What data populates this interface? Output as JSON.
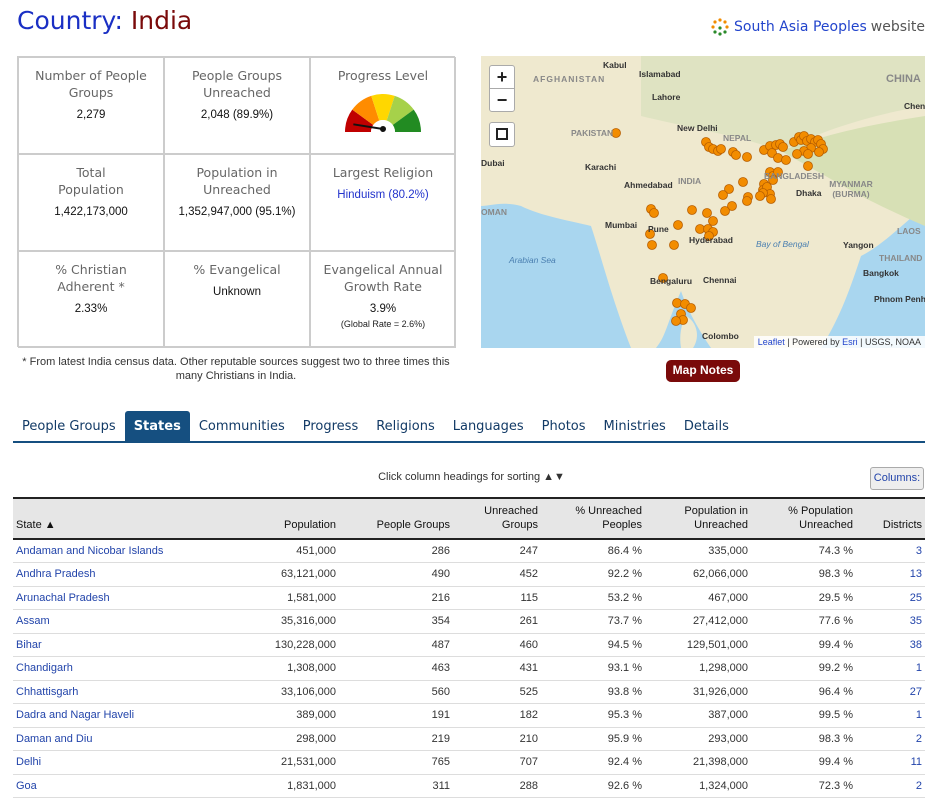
{
  "title": {
    "label": "Country:",
    "value": "India"
  },
  "sap_link": {
    "name": "South Asia Peoples",
    "suffix": "website"
  },
  "stats": {
    "num_groups": {
      "label": "Number of People Groups",
      "value": "2,279"
    },
    "unreached": {
      "label": "People Groups Unreached",
      "value": "2,048 (89.9%)"
    },
    "progress": {
      "label": "Progress Level",
      "level_fraction": 0.05,
      "colors": [
        "#c00000",
        "#ff8c00",
        "#ffd700",
        "#a6d14a",
        "#228b22"
      ]
    },
    "total_pop": {
      "label": "Total Population",
      "value": "1,422,173,000"
    },
    "pop_unreached": {
      "label": "Population in Unreached",
      "value": "1,352,947,000 (95.1%)"
    },
    "religion": {
      "label": "Largest Religion",
      "value": "Hinduism (80.2%)"
    },
    "christian": {
      "label": "% Christian Adherent *",
      "value": "2.33%"
    },
    "evangelical": {
      "label": "% Evangelical",
      "value": "Unknown"
    },
    "growth": {
      "label": "Evangelical Annual Growth Rate",
      "value": "3.9%",
      "note": "(Global Rate = 2.6%)"
    }
  },
  "footnote": "* From latest India census data. Other reputable sources suggest two to three times this many Christians in India.",
  "map": {
    "zoom_in": "+",
    "zoom_out": "−",
    "fullscreen_icon": "fullscreen-icon",
    "labels": {
      "kabul": "Kabul",
      "islamabad": "Islamabad",
      "lahore": "Lahore",
      "afghanistan": "AFGHANISTAN",
      "pakistan": "PAKISTAN",
      "newdelhi": "New Delhi",
      "nepal": "NEPAL",
      "china": "CHINA",
      "chen": "Chen",
      "dubai": "Dubai",
      "karachi": "Karachi",
      "ahmedabad": "Ahmedabad",
      "india": "INDIA",
      "bangladesh": "BANGLADESH",
      "dhaka": "Dhaka",
      "myanmar": "MYANMAR (BURMA)",
      "oman": "OMAN",
      "mumbai": "Mumbai",
      "pune": "Pune",
      "hyderabad": "Hyderabad",
      "bay": "Bay of Bengal",
      "yangon": "Yangon",
      "laos": "LAOS",
      "arabian": "Arabian Sea",
      "thailand": "THAILAND",
      "bengaluru": "Bengaluru",
      "chennai": "Chennai",
      "bangkok": "Bangkok",
      "phnompenh": "Phnom Penh",
      "colombo": "Colombo"
    },
    "attribution": {
      "leaflet": "Leaflet",
      "powered": "| Powered by",
      "esri": "Esri",
      "sources": "| USGS, NOAA"
    },
    "marker_color": "#f28c00"
  },
  "map_notes": "Map Notes",
  "tabs": [
    {
      "label": "People Groups"
    },
    {
      "label": "States",
      "active": true
    },
    {
      "label": "Communities"
    },
    {
      "label": "Progress"
    },
    {
      "label": "Religions"
    },
    {
      "label": "Languages"
    },
    {
      "label": "Photos"
    },
    {
      "label": "Ministries"
    },
    {
      "label": "Details"
    }
  ],
  "sort_hint": "Click column headings for sorting ▲▼",
  "columns_button": "Columns:",
  "table": {
    "headers": [
      "State ▲",
      "Population",
      "People Groups",
      "Unreached Groups",
      "% Unreached Peoples",
      "Population in Unreached",
      "% Population Unreached",
      "Districts"
    ],
    "rows": [
      [
        "Andaman and Nicobar Islands",
        "451,000",
        "286",
        "247",
        "86.4 %",
        "335,000",
        "74.3 %",
        "3"
      ],
      [
        "Andhra Pradesh",
        "63,121,000",
        "490",
        "452",
        "92.2 %",
        "62,066,000",
        "98.3 %",
        "13"
      ],
      [
        "Arunachal Pradesh",
        "1,581,000",
        "216",
        "115",
        "53.2 %",
        "467,000",
        "29.5 %",
        "25"
      ],
      [
        "Assam",
        "35,316,000",
        "354",
        "261",
        "73.7 %",
        "27,412,000",
        "77.6 %",
        "35"
      ],
      [
        "Bihar",
        "130,228,000",
        "487",
        "460",
        "94.5 %",
        "129,501,000",
        "99.4 %",
        "38"
      ],
      [
        "Chandigarh",
        "1,308,000",
        "463",
        "431",
        "93.1 %",
        "1,298,000",
        "99.2 %",
        "1"
      ],
      [
        "Chhattisgarh",
        "33,106,000",
        "560",
        "525",
        "93.8 %",
        "31,926,000",
        "96.4 %",
        "27"
      ],
      [
        "Dadra and Nagar Haveli",
        "389,000",
        "191",
        "182",
        "95.3 %",
        "387,000",
        "99.5 %",
        "1"
      ],
      [
        "Daman and Diu",
        "298,000",
        "219",
        "210",
        "95.9 %",
        "293,000",
        "98.3 %",
        "2"
      ],
      [
        "Delhi",
        "21,531,000",
        "765",
        "707",
        "92.4 %",
        "21,398,000",
        "99.4 %",
        "11"
      ],
      [
        "Goa",
        "1,831,000",
        "311",
        "288",
        "92.6 %",
        "1,324,000",
        "72.3 %",
        "2"
      ]
    ]
  }
}
